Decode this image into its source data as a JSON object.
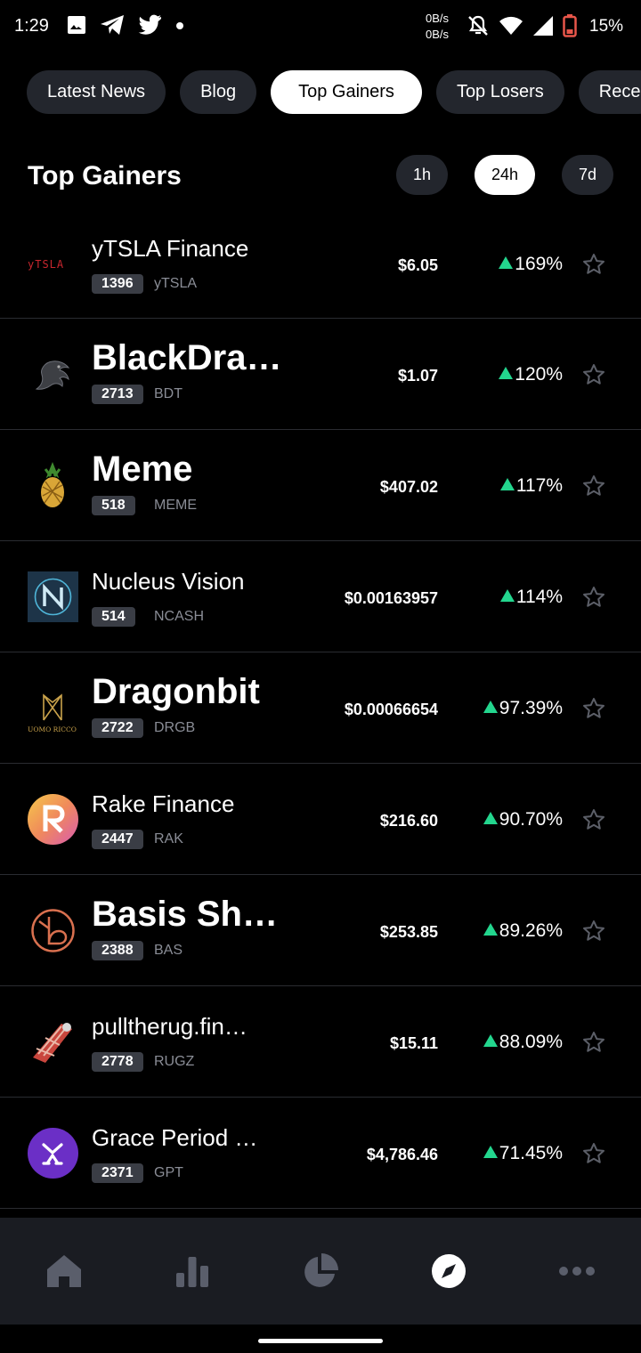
{
  "status": {
    "time": "1:29",
    "net_up": "0B/s",
    "net_down": "0B/s",
    "battery": "15%"
  },
  "tabs": [
    {
      "label": "Latest News",
      "active": false
    },
    {
      "label": "Blog",
      "active": false
    },
    {
      "label": "Top Gainers",
      "active": true
    },
    {
      "label": "Top Losers",
      "active": false
    },
    {
      "label": "Rece",
      "active": false
    }
  ],
  "section": {
    "title": "Top Gainers"
  },
  "ranges": [
    {
      "label": "1h",
      "active": false
    },
    {
      "label": "24h",
      "active": true
    },
    {
      "label": "7d",
      "active": false
    }
  ],
  "colors": {
    "gain": "#23d68e",
    "chip": "#23262d",
    "nav_bg": "#1a1c22"
  },
  "coins": [
    {
      "name": "yTSLA Finance",
      "rank": "1396",
      "symbol": "yTSLA",
      "price": "$6.05",
      "change": "169%",
      "logo": "ytsla-logo"
    },
    {
      "name": "BlackDra…",
      "rank": "2713",
      "symbol": "BDT",
      "price": "$1.07",
      "change": "120%",
      "logo": "dragon-logo"
    },
    {
      "name": "Meme",
      "rank": "518",
      "symbol": "MEME",
      "price": "$407.02",
      "change": "117%",
      "logo": "pineapple-logo"
    },
    {
      "name": "Nucleus Vision",
      "rank": "514",
      "symbol": "NCASH",
      "price": "$0.00163957",
      "change": "114%",
      "logo": "nucleus-logo"
    },
    {
      "name": "Dragonbit",
      "rank": "2722",
      "symbol": "DRGB",
      "price": "$0.00066654",
      "change": "97.39%",
      "logo": "uomo-ricco-logo",
      "logo_text": "UOMO RICCO"
    },
    {
      "name": "Rake Finance",
      "rank": "2447",
      "symbol": "RAK",
      "price": "$216.60",
      "change": "90.70%",
      "logo": "rake-logo"
    },
    {
      "name": "Basis Sh…",
      "rank": "2388",
      "symbol": "BAS",
      "price": "$253.85",
      "change": "89.26%",
      "logo": "basis-logo"
    },
    {
      "name": "pulltherug.fin…",
      "rank": "2778",
      "symbol": "RUGZ",
      "price": "$15.11",
      "change": "88.09%",
      "logo": "rug-logo"
    },
    {
      "name": "Grace Period …",
      "rank": "2371",
      "symbol": "GPT",
      "price": "$4,786.46",
      "change": "71.45%",
      "logo": "grace-logo"
    }
  ],
  "nav": [
    "home-icon",
    "bar-chart-icon",
    "pie-chart-icon",
    "compass-icon",
    "more-icon"
  ]
}
